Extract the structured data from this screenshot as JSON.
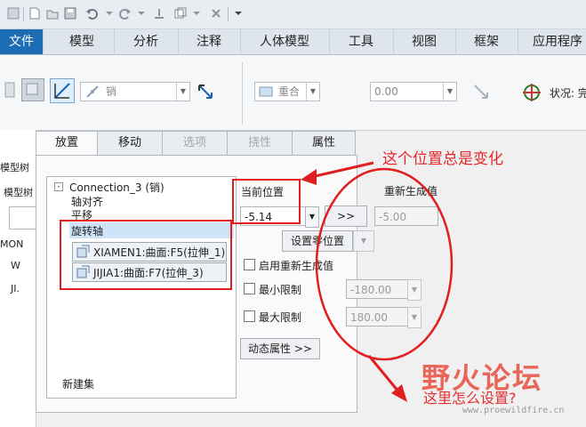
{
  "ribbon_tabs": [
    {
      "label": "文件",
      "active": true
    },
    {
      "label": "模型"
    },
    {
      "label": "分析"
    },
    {
      "label": "注释"
    },
    {
      "label": "人体模型"
    },
    {
      "label": "工具"
    },
    {
      "label": "视图"
    },
    {
      "label": "框架"
    },
    {
      "label": "应用程序"
    }
  ],
  "ribbon": {
    "connection_type": "销",
    "constraint_type": "重合",
    "offset_value": "0.00",
    "status_label": "状况: 完"
  },
  "tree": {
    "header": "模型树",
    "header2": "模型树",
    "items": [
      "MON",
      "W",
      "JI."
    ]
  },
  "dialog_tabs": [
    {
      "label": "放置",
      "state": "active"
    },
    {
      "label": "移动",
      "state": "normal"
    },
    {
      "label": "选项",
      "state": "disabled"
    },
    {
      "label": "挠性",
      "state": "disabled"
    },
    {
      "label": "属性",
      "state": "normal"
    }
  ],
  "connection": {
    "name": "Connection_3 (销)",
    "items": [
      "轴对齐",
      "平移",
      "旋转轴"
    ],
    "refs": [
      "XIAMEN1:曲面:F5(拉伸_1)",
      "JIJIA1:曲面:F7(拉伸_3)"
    ],
    "new_set": "新建集"
  },
  "position": {
    "current_label": "当前位置",
    "current_value": "-5.14",
    "arrow_button": ">>",
    "regen_label": "重新生成值",
    "regen_value": "-5.00",
    "set_zero_button": "设置零位置",
    "enable_regen": "启用重新生成值",
    "min_limit": "最小限制",
    "min_value": "-180.00",
    "max_limit": "最大限制",
    "max_value": "180.00",
    "dynamic_props": "动态属性 >>"
  },
  "annotations": {
    "top": "这个位置总是变化",
    "bottom": "这里怎么设置?"
  },
  "watermark": {
    "logo": "野火论坛",
    "url": "www.proewildfire.cn"
  },
  "colors": {
    "active_tab": "#1c6db3",
    "annotation_red": "#e4272b",
    "selection": "#cfe4f8"
  }
}
